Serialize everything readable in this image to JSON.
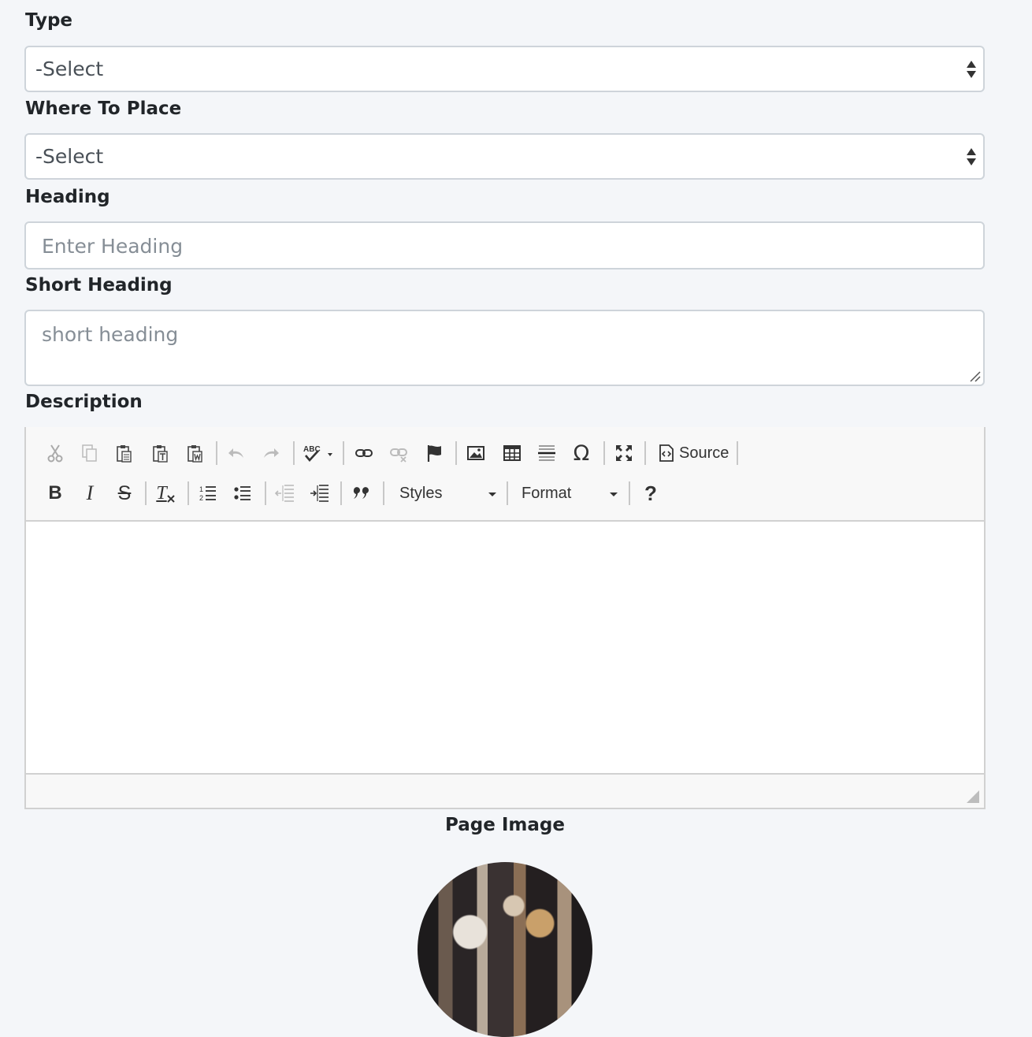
{
  "form": {
    "type": {
      "label": "Type",
      "value": "-Select"
    },
    "where_to_place": {
      "label": "Where To Place",
      "value": "-Select"
    },
    "heading": {
      "label": "Heading",
      "placeholder": "Enter Heading"
    },
    "short_heading": {
      "label": "Short Heading",
      "placeholder": "short heading"
    },
    "description": {
      "label": "Description"
    },
    "page_image": {
      "label": "Page Image"
    }
  },
  "editor": {
    "toolbar_row1": [
      "cut-icon",
      "copy-icon",
      "paste-icon",
      "paste-text-icon",
      "paste-word-icon",
      "undo-icon",
      "redo-icon",
      "spellcheck-icon",
      "link-icon",
      "unlink-icon",
      "anchor-icon",
      "image-icon",
      "table-icon",
      "horizontal-line-icon",
      "special-char-icon",
      "maximize-icon",
      "source-icon"
    ],
    "source_label": "Source",
    "toolbar_row2": [
      "bold-icon",
      "italic-icon",
      "strikethrough-icon",
      "remove-format-icon",
      "numbered-list-icon",
      "bulleted-list-icon",
      "outdent-icon",
      "indent-icon",
      "blockquote-icon",
      "help-icon"
    ],
    "styles_label": "Styles",
    "format_label": "Format",
    "spell_text": "ABC",
    "bold_text": "B",
    "italic_text": "I",
    "strike_text": "S",
    "clear_text": "T",
    "omega_text": "Ω",
    "help_text": "?"
  }
}
